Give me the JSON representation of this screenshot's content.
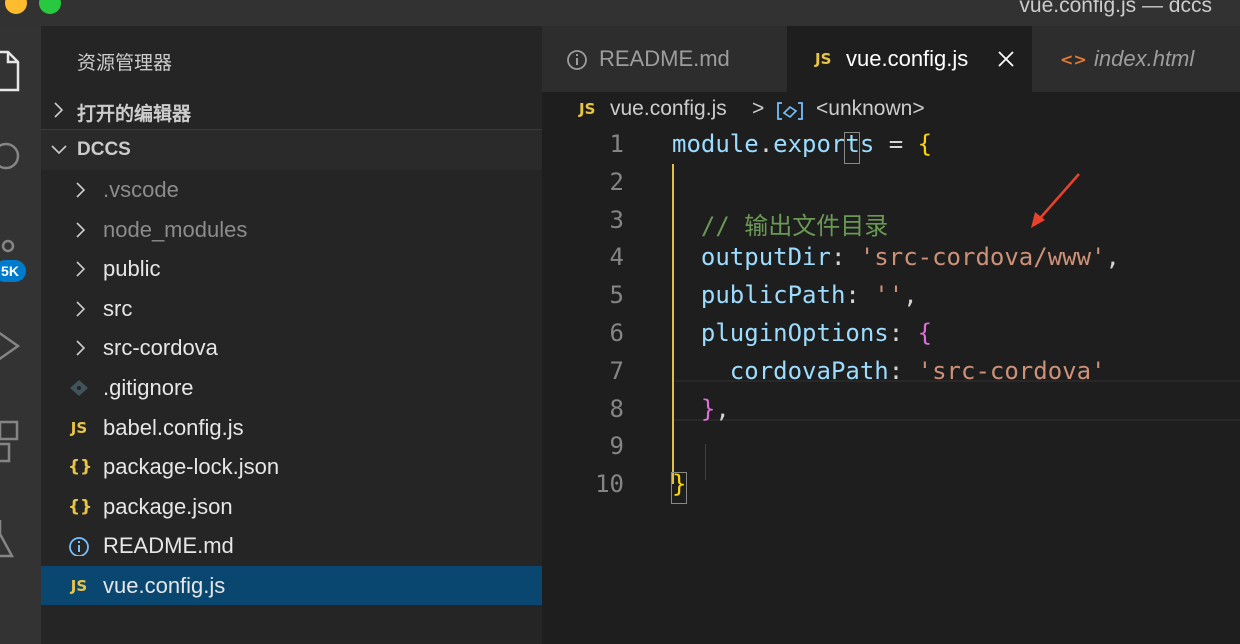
{
  "window": {
    "title": "vue.config.js — dccs"
  },
  "activity_bar": {
    "badge": "5K"
  },
  "sidebar": {
    "title": "资源管理器",
    "sections": [
      {
        "label": "打开的编辑器"
      },
      {
        "label": "DCCS"
      }
    ],
    "items": [
      {
        "label": ".vscode",
        "type": "folder",
        "icon": "chevron-right-icon",
        "dimmed": true
      },
      {
        "label": "node_modules",
        "type": "folder",
        "icon": "chevron-right-icon",
        "dimmed": true
      },
      {
        "label": "public",
        "type": "folder",
        "icon": "chevron-right-icon"
      },
      {
        "label": "src",
        "type": "folder",
        "icon": "chevron-right-icon"
      },
      {
        "label": "src-cordova",
        "type": "folder",
        "icon": "chevron-right-icon"
      },
      {
        "label": ".gitignore",
        "type": "file",
        "icon": "git-icon"
      },
      {
        "label": "babel.config.js",
        "type": "file",
        "icon": "js-file-icon",
        "icon_text": "JS"
      },
      {
        "label": "package-lock.json",
        "type": "file",
        "icon": "json-file-icon",
        "icon_text": "{}"
      },
      {
        "label": "package.json",
        "type": "file",
        "icon": "json-file-icon",
        "icon_text": "{}"
      },
      {
        "label": "README.md",
        "type": "file",
        "icon": "info-icon"
      },
      {
        "label": "vue.config.js",
        "type": "file",
        "icon": "js-file-icon",
        "icon_text": "JS",
        "selected": true
      }
    ]
  },
  "tabs": [
    {
      "label": "README.md",
      "icon": "info-icon"
    },
    {
      "label": "vue.config.js",
      "icon": "js-file-icon",
      "icon_text": "JS",
      "active": true
    },
    {
      "label": "index.html",
      "icon": "html-icon",
      "icon_text": "<>",
      "italic": true
    }
  ],
  "breadcrumb": {
    "file_icon_text": "JS",
    "file": "vue.config.js",
    "separator": ">",
    "symbol": "<unknown>"
  },
  "code": {
    "line_numbers": [
      "1",
      "2",
      "3",
      "4",
      "5",
      "6",
      "7",
      "8",
      "9",
      "10"
    ],
    "lines": [
      {
        "t": [
          [
            "module",
            "var"
          ],
          [
            ".",
            "op"
          ],
          [
            "exports",
            "var"
          ],
          [
            " = ",
            "op"
          ],
          [
            "{",
            "brace"
          ]
        ]
      },
      {
        "t": []
      },
      {
        "t": [
          [
            "  // 输出文件目录",
            "cmt"
          ]
        ]
      },
      {
        "t": [
          [
            "  outputDir",
            "var"
          ],
          [
            ": ",
            "op"
          ],
          [
            "'src-cordova/www'",
            "str"
          ],
          [
            ",",
            "op"
          ]
        ]
      },
      {
        "t": [
          [
            "  publicPath",
            "var"
          ],
          [
            ": ",
            "op"
          ],
          [
            "''",
            "str"
          ],
          [
            ",",
            "op"
          ]
        ]
      },
      {
        "t": [
          [
            "  pluginOptions",
            "var"
          ],
          [
            ": ",
            "op"
          ],
          [
            "{",
            "brace2"
          ]
        ]
      },
      {
        "t": [
          [
            "    cordovaPath",
            "var"
          ],
          [
            ": ",
            "op"
          ],
          [
            "'src-cordova'",
            "str"
          ]
        ]
      },
      {
        "t": [
          [
            "  ",
            "op"
          ],
          [
            "}",
            "brace2"
          ],
          [
            ",",
            "op"
          ]
        ]
      },
      {
        "t": []
      },
      {
        "t": [
          [
            "}",
            "brace"
          ]
        ]
      }
    ]
  },
  "colors": {
    "accent": "#094771",
    "arrow": "#e8412c",
    "bracket_guide": "#e0c04a"
  }
}
